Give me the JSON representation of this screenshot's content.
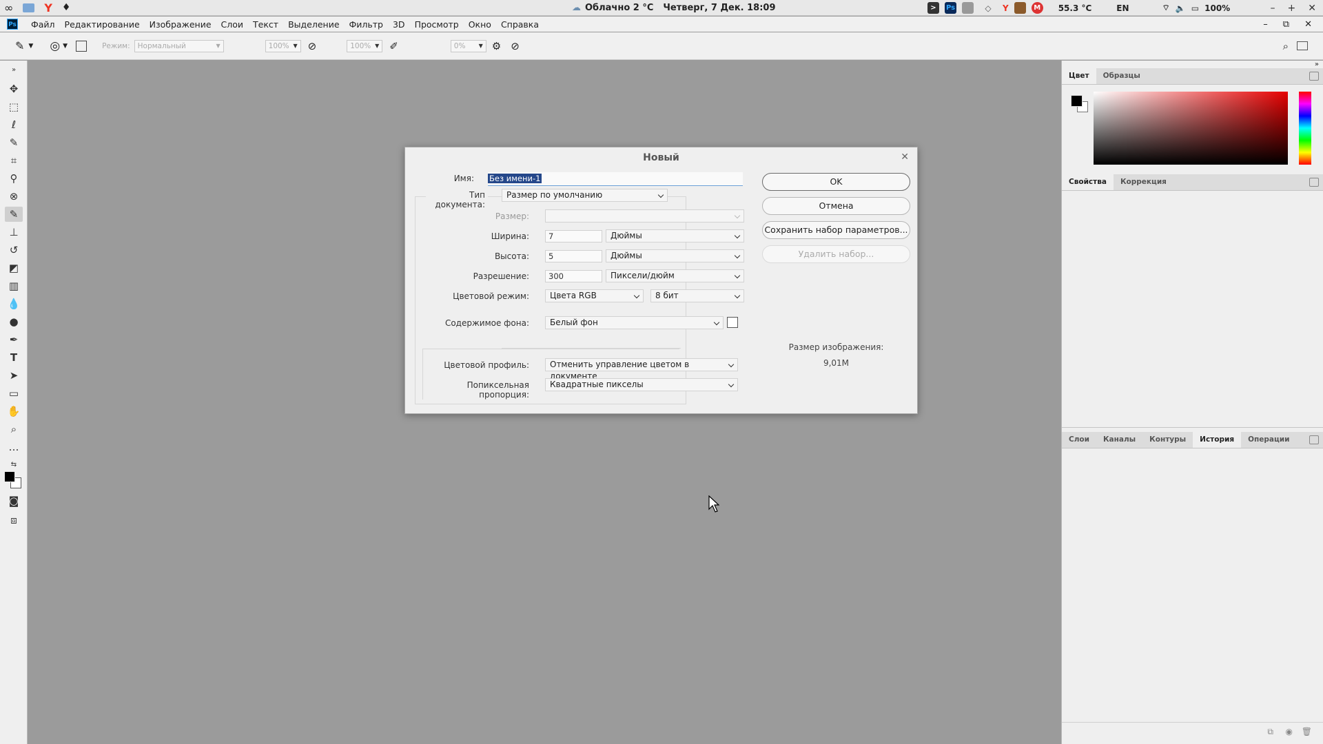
{
  "system": {
    "weather": "Облачно 2 °C",
    "datetime": "Четверг,  7 Дек. 18:09",
    "temperature": "55.3 °C",
    "lang": "EN",
    "battery": "100%"
  },
  "menu": {
    "items": [
      "Файл",
      "Редактирование",
      "Изображение",
      "Слои",
      "Текст",
      "Выделение",
      "Фильтр",
      "3D",
      "Просмотр",
      "Окно",
      "Справка"
    ]
  },
  "options": {
    "mode_label": "Режим:",
    "mode_value": "Нормальный",
    "opacity": "100%",
    "flow": "100%",
    "smoothing": "0%"
  },
  "panels": {
    "top_tabs": [
      "Цвет",
      "Образцы"
    ],
    "mid_tabs": [
      "Свойства",
      "Коррекция"
    ],
    "bottom_tabs": [
      "Слои",
      "Каналы",
      "Контуры",
      "История",
      "Операции"
    ]
  },
  "dialog": {
    "title": "Новый",
    "name_label": "Имя:",
    "name_value": "Без имени-1",
    "doctype_label": "Тип документа:",
    "doctype_value": "Размер по умолчанию",
    "size_label": "Размер:",
    "width_label": "Ширина:",
    "width_value": "7",
    "width_unit": "Дюймы",
    "height_label": "Высота:",
    "height_value": "5",
    "height_unit": "Дюймы",
    "resolution_label": "Разрешение:",
    "resolution_value": "300",
    "resolution_unit": "Пиксели/дюйм",
    "colormode_label": "Цветовой режим:",
    "colormode_value": "Цвета RGB",
    "bitdepth_value": "8 бит",
    "bg_label": "Содержимое фона:",
    "bg_value": "Белый фон",
    "profile_label": "Цветовой профиль:",
    "profile_value": "Отменить управление цветом в документе",
    "pixel_label": "Попиксельная пропорция:",
    "pixel_value": "Квадратные пикселы",
    "ok": "OK",
    "cancel": "Отмена",
    "save_preset": "Сохранить набор параметров...",
    "delete_preset": "Удалить набор...",
    "image_size_label": "Размер изображения:",
    "image_size_value": "9,01M"
  }
}
